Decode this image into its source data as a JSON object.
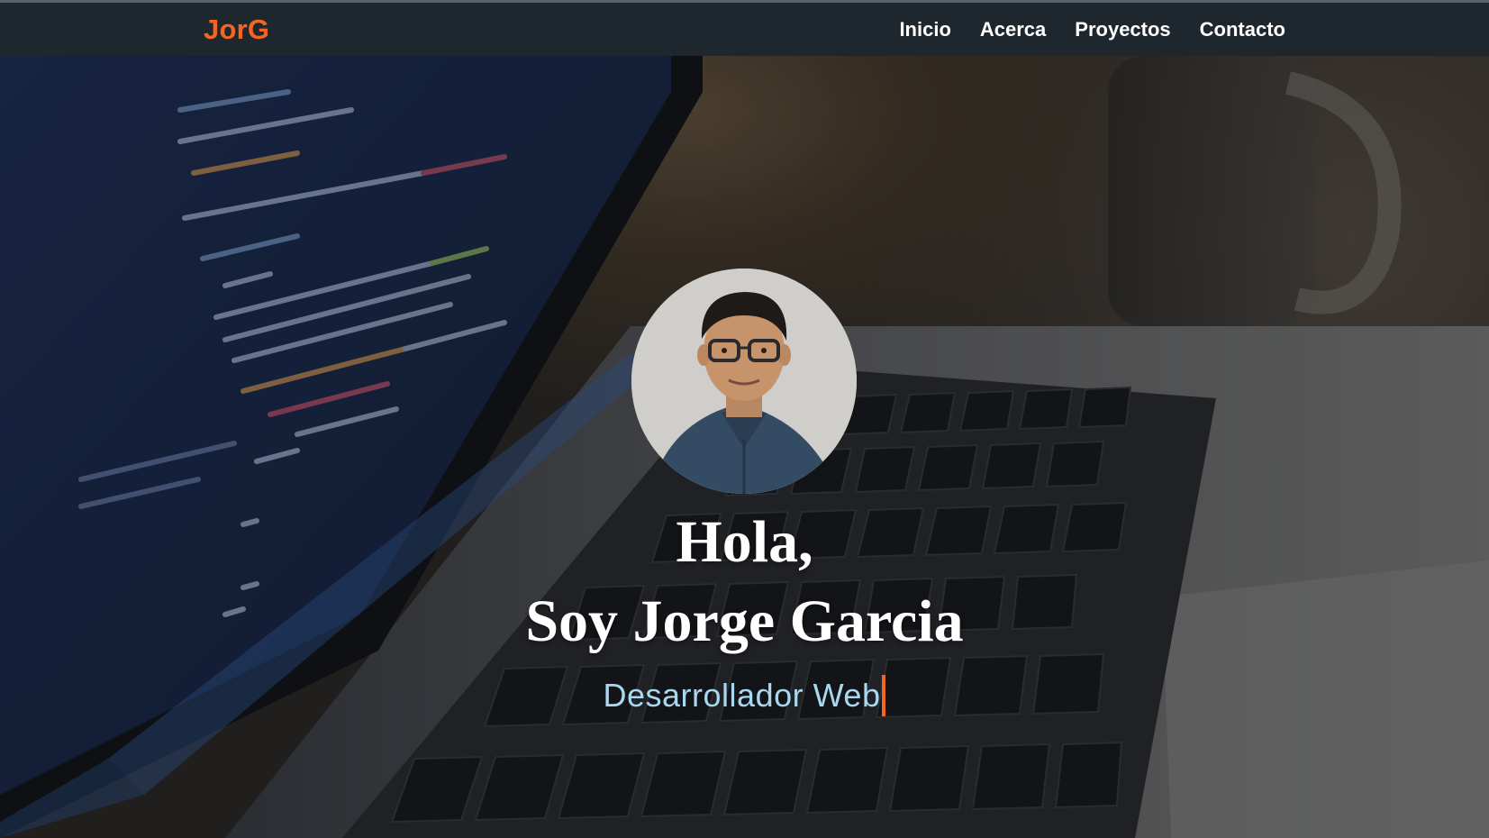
{
  "navbar": {
    "brand": "JorG",
    "links": [
      {
        "label": "Inicio"
      },
      {
        "label": "Acerca"
      },
      {
        "label": "Proyectos"
      },
      {
        "label": "Contacto"
      }
    ]
  },
  "hero": {
    "greeting_line1": "Hola,",
    "greeting_line2": "Soy Jorge Garcia",
    "role": "Desarrollador Web"
  },
  "colors": {
    "accent": "#f26522",
    "nav_bg": "#1f272e",
    "role_text": "#a9d7ef"
  },
  "icons": {
    "avatar": "profile-photo",
    "background": "laptop-code-photo"
  }
}
